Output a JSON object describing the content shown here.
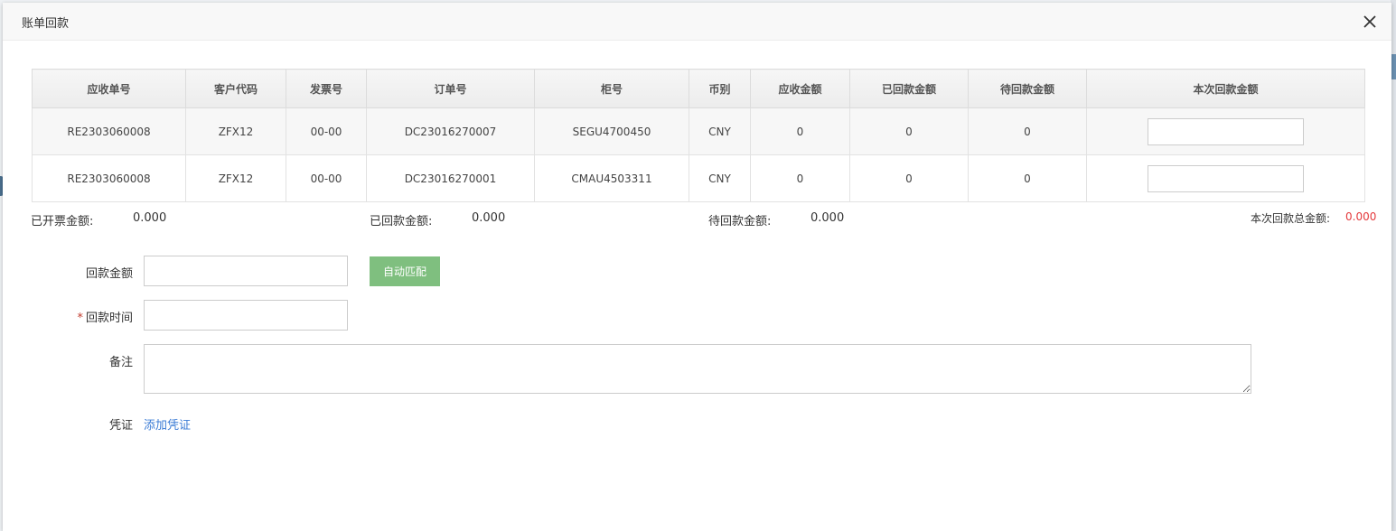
{
  "dialog": {
    "title": "账单回款",
    "close_icon": "close-icon"
  },
  "table": {
    "headers": [
      "应收单号",
      "客户代码",
      "发票号",
      "订单号",
      "柜号",
      "币别",
      "应收金额",
      "已回款金额",
      "待回款金额",
      "本次回款金额"
    ],
    "rows": [
      {
        "receivable_no": "RE2303060008",
        "customer_code": "ZFX12",
        "invoice_no": "00-00",
        "order_no": "DC23016270007",
        "container_no": "SEGU4700450",
        "currency": "CNY",
        "receivable_amount": "0",
        "paid_amount": "0",
        "pending_amount": "0",
        "current_payment": ""
      },
      {
        "receivable_no": "RE2303060008",
        "customer_code": "ZFX12",
        "invoice_no": "00-00",
        "order_no": "DC23016270001",
        "container_no": "CMAU4503311",
        "currency": "CNY",
        "receivable_amount": "0",
        "paid_amount": "0",
        "pending_amount": "0",
        "current_payment": ""
      }
    ]
  },
  "summary": {
    "invoiced_label": "已开票金额:",
    "invoiced_value": "0.000",
    "paid_label": "已回款金额:",
    "paid_value": "0.000",
    "pending_label": "待回款金额:",
    "pending_value": "0.000",
    "total_label": "本次回款总金额:",
    "total_value": "0.000",
    "total_color": "#e4393c"
  },
  "form": {
    "amount_label": "回款金额",
    "amount_value": "",
    "auto_match_label": "自动匹配",
    "auto_match_color": "#7fbf7f",
    "required_mark": "*",
    "time_label": "回款时间",
    "time_value": "",
    "remark_label": "备注",
    "remark_value": "",
    "voucher_label": "凭证",
    "add_voucher_link": "添加凭证",
    "link_color": "#3a7bd5"
  }
}
